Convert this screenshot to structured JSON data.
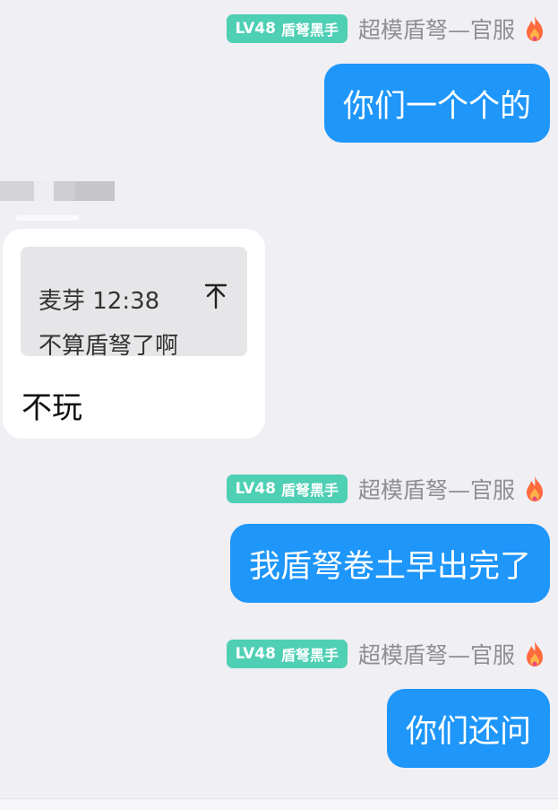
{
  "messages": [
    {
      "badge": {
        "level": "LV48",
        "title": "盾弩黑手"
      },
      "sender": "超模盾弩—官服",
      "text": "你们一个个的"
    },
    {
      "badge": {
        "level": "LV48",
        "title": "盾弩黑手"
      },
      "sender": "超模盾弩—官服",
      "text": "我盾弩卷土早出完了"
    },
    {
      "badge": {
        "level": "LV48",
        "title": "盾弩黑手"
      },
      "sender": "超模盾弩—官服",
      "text": "你们还问"
    }
  ],
  "incoming": {
    "quote": {
      "author_time": "麦芽 12:38",
      "text": "不算盾弩了啊"
    },
    "text": "不玩"
  },
  "icons": {
    "sender_flair": "fire-icon",
    "quote_jump": "scroll-to-top-icon"
  },
  "colors": {
    "outgoing_bubble": "#1e96fa",
    "badge": "#4fcfb4",
    "background": "#efeff4"
  }
}
